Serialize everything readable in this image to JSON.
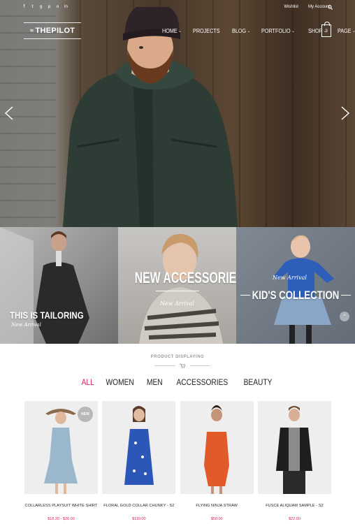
{
  "topbar": {
    "social_icons": [
      "facebook-icon",
      "twitter-icon",
      "google-plus-icon",
      "pinterest-icon",
      "instagram-icon",
      "linkedin-icon"
    ],
    "social_glyphs": [
      "f",
      "t",
      "g",
      "p",
      "o",
      "in"
    ],
    "wishlist": "Wishlist",
    "account": "My Account"
  },
  "logo": {
    "text": "THEPILOT"
  },
  "nav": {
    "items": [
      {
        "label": "HOME",
        "has_dropdown": true
      },
      {
        "label": "PROJECTS",
        "has_dropdown": false
      },
      {
        "label": "BLOG",
        "has_dropdown": true
      },
      {
        "label": "PORTFOLIO",
        "has_dropdown": true
      },
      {
        "label": "SHOP",
        "has_dropdown": true
      },
      {
        "label": "PAGE",
        "has_dropdown": true
      }
    ],
    "cart_count": "3"
  },
  "banners": [
    {
      "title": "THIS IS TAILORING",
      "subtitle": "New Arrival"
    },
    {
      "title": "NEW ACCESSORIES",
      "subtitle": "New Arrival"
    },
    {
      "title": "KID'S COLLECTION",
      "subtitle": "New Arrival"
    }
  ],
  "products_section": {
    "label": "PRODUCT DISPLAYING",
    "filters": [
      "ALL",
      "WOMEN",
      "MEN",
      "ACCESSORIES",
      "BEAUTY"
    ],
    "active_filter": "ALL",
    "items": [
      {
        "name": "COLLARLESS PLAYSUIT WHITE SHIRT",
        "price": "$18.20 - $20.00",
        "badge": "NEW"
      },
      {
        "name": "FLORAL GOLD COLLAR CHUNKY - S2",
        "price": "$110.00"
      },
      {
        "name": "FLYING NINJA STRAW",
        "price": "$50.00"
      },
      {
        "name": "FUSCE ALIQUAM SAMPLE - S2",
        "price": "$22.00"
      }
    ]
  },
  "colors": {
    "accent": "#d6245f",
    "text": "#222222",
    "muted": "#9a9a9a"
  }
}
